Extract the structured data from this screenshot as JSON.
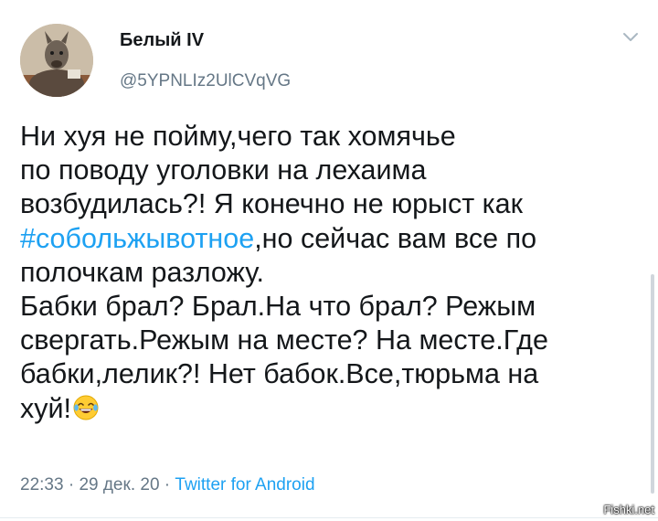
{
  "author": {
    "display_name": "Белый IV",
    "handle": "@5YPNLIz2UlCVqVG",
    "avatar_icon": "avatar-image"
  },
  "tweet": {
    "lines": [
      [
        {
          "text": "Ни хуя не пойму,чего так хомячье",
          "hashtag": false
        }
      ],
      [
        {
          "text": "по поводу уголовки на лехаима",
          "hashtag": false
        }
      ],
      [
        {
          "text": "возбудилась?! Я конечно не юрыст как",
          "hashtag": false
        }
      ],
      [
        {
          "text": "#собольжывотное",
          "hashtag": true
        },
        {
          "text": ",но сейчас вам все по",
          "hashtag": false
        }
      ],
      [
        {
          "text": "полочкам разложу.",
          "hashtag": false
        }
      ],
      [
        {
          "text": "Бабки брал? Брал.На что брал? Режым",
          "hashtag": false
        }
      ],
      [
        {
          "text": "свергать.Режым на месте? На месте.Где",
          "hashtag": false
        }
      ],
      [
        {
          "text": "бабки,лелик?! Нет бабок.Все,тюрьма на",
          "hashtag": false
        }
      ],
      [
        {
          "text": "хуй!",
          "hashtag": false
        }
      ]
    ],
    "emoji": "tears-of-joy-emoji"
  },
  "meta": {
    "time": "22:33",
    "date": "29 дек. 20",
    "separator": "·",
    "source": "Twitter for Android"
  },
  "watermark": "Fishki.net",
  "colors": {
    "link": "#1da1f2",
    "secondary": "#657786",
    "text": "#14171a"
  }
}
